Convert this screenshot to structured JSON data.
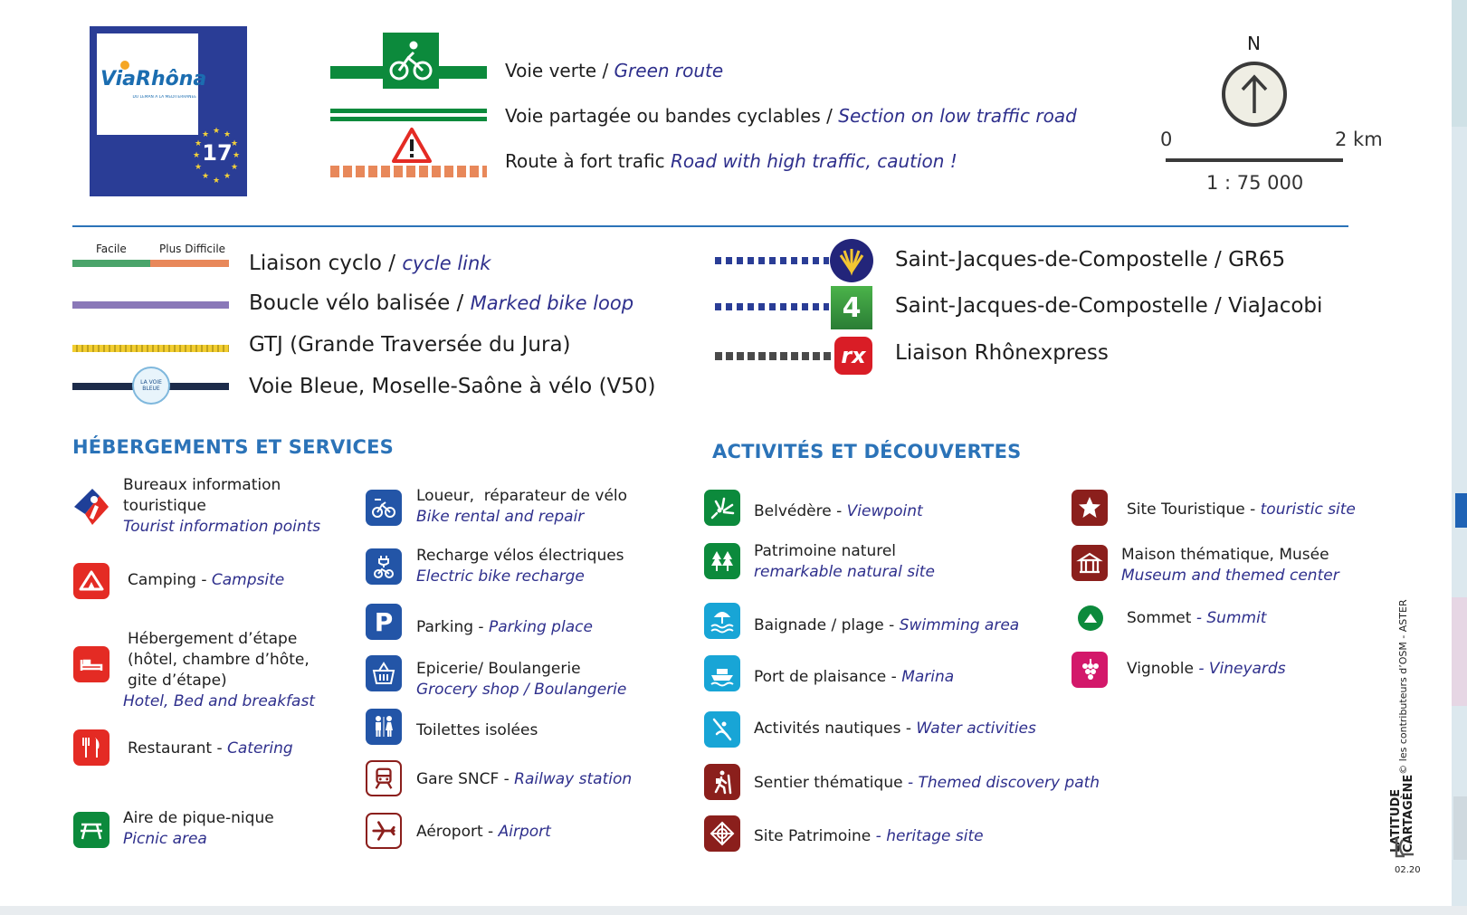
{
  "logo": {
    "brand": "ViaRhôna",
    "tagline": "DU LÉMAN À LA MÉDITERRANÉE",
    "number": "17"
  },
  "routes": [
    {
      "fr": "Voie verte / ",
      "en": "Green route"
    },
    {
      "fr": "Voie partagée ou bandes cyclables / ",
      "en": "Section on low traffic road"
    },
    {
      "fr": "Route à fort trafic ",
      "en": "Road with high traffic, caution !"
    }
  ],
  "compass": {
    "north": "N"
  },
  "scale": {
    "zero": "0",
    "max": "2 km",
    "ratio": "1 : 75 000"
  },
  "cyclo": {
    "easy": "Facile",
    "hard": "Plus Difficile"
  },
  "bike_routes": {
    "liaison": {
      "fr": "Liaison cyclo / ",
      "en": "cycle link"
    },
    "boucle": {
      "fr": "Boucle vélo balisée / ",
      "en": "Marked bike loop"
    },
    "gtj": {
      "fr": "GTJ (Grande Traversée du Jura)"
    },
    "voie_bleue": {
      "fr": "Voie Bleue, Moselle-Saône à vélo (V50)",
      "badge": "LA VOIE BLEUE"
    },
    "gr65": {
      "fr": "Saint-Jacques-de-Compostelle / GR65"
    },
    "viajacobi": {
      "fr": "Saint-Jacques-de-Compostelle / ViaJacobi",
      "badge": "4"
    },
    "rhonexpress": {
      "fr": "Liaison Rhônexpress",
      "badge": "rx"
    }
  },
  "sections": {
    "services": "HÉBERGEMENTS ET SERVICES",
    "activities": "ACTIVITÉS ET DÉCOUVERTES"
  },
  "services_left": {
    "info": {
      "fr": "Bureaux information touristique",
      "en": "Tourist information points"
    },
    "camping": {
      "fr": "Camping - ",
      "en": "Campsite"
    },
    "hebergement": {
      "fr": "Hébergement d’étape (hôtel, chambre d’hôte, gite d’étape)",
      "en": "Hotel, Bed and breakfast"
    },
    "restaurant": {
      "fr": "Restaurant - ",
      "en": "Catering"
    },
    "picnic": {
      "fr": "Aire de pique-nique",
      "en": "Picnic area"
    }
  },
  "services_right": {
    "loueur": {
      "fr": "Loueur,  réparateur de vélo",
      "en": "Bike rental and repair"
    },
    "recharge": {
      "fr": "Recharge vélos électriques",
      "en": "Electric bike recharge"
    },
    "parking": {
      "fr": "Parking - ",
      "en": "Parking place",
      "badge": "P"
    },
    "epicerie": {
      "fr": "Epicerie/ Boulangerie",
      "en": "Grocery shop / Boulangerie"
    },
    "toilettes": {
      "fr": "Toilettes isolées"
    },
    "gare": {
      "fr": "Gare SNCF - ",
      "en": "Railway station"
    },
    "aeroport": {
      "fr": "Aéroport - ",
      "en": "Airport"
    }
  },
  "activities_left": {
    "belvedere": {
      "fr": "Belvédère - ",
      "en": "Viewpoint"
    },
    "patrimoine": {
      "fr": "Patrimoine naturel",
      "en": "remarkable natural site"
    },
    "baignade": {
      "fr": "Baignade / plage - ",
      "en": "Swimming area"
    },
    "port": {
      "fr": "Port de plaisance - ",
      "en": "Marina"
    },
    "nautique": {
      "fr": "Activités nautiques - ",
      "en": "Water activities"
    },
    "sentier": {
      "fr": "Sentier thématique ",
      "en": "- Themed discovery path"
    },
    "heritage": {
      "fr": "Site Patrimoine ",
      "en": "- heritage site"
    }
  },
  "activities_right": {
    "touristique": {
      "fr": "Site Touristique - ",
      "en": "touristic site"
    },
    "musee": {
      "fr": "Maison thématique, Musée",
      "en": "Museum and themed center"
    },
    "sommet": {
      "fr": "Sommet ",
      "en": "- Summit"
    },
    "vignoble": {
      "fr": "Vignoble ",
      "en": "- Vineyards"
    }
  },
  "credits": {
    "brand_line1": "LATITUDE",
    "brand_line2": "CARTAGÈNE",
    "copyright": " © les contributeurs d’OSM - ASTER",
    "version": "02.20"
  },
  "colors": {
    "green": "#0c8a3c",
    "orange": "#e8885a",
    "purple": "#8a78b8",
    "yellow": "#f2cd2f",
    "navy": "#1c2b4a",
    "title_blue": "#2b73b8",
    "en_text": "#2e2f8c",
    "eu_blue": "#2a3d96"
  }
}
